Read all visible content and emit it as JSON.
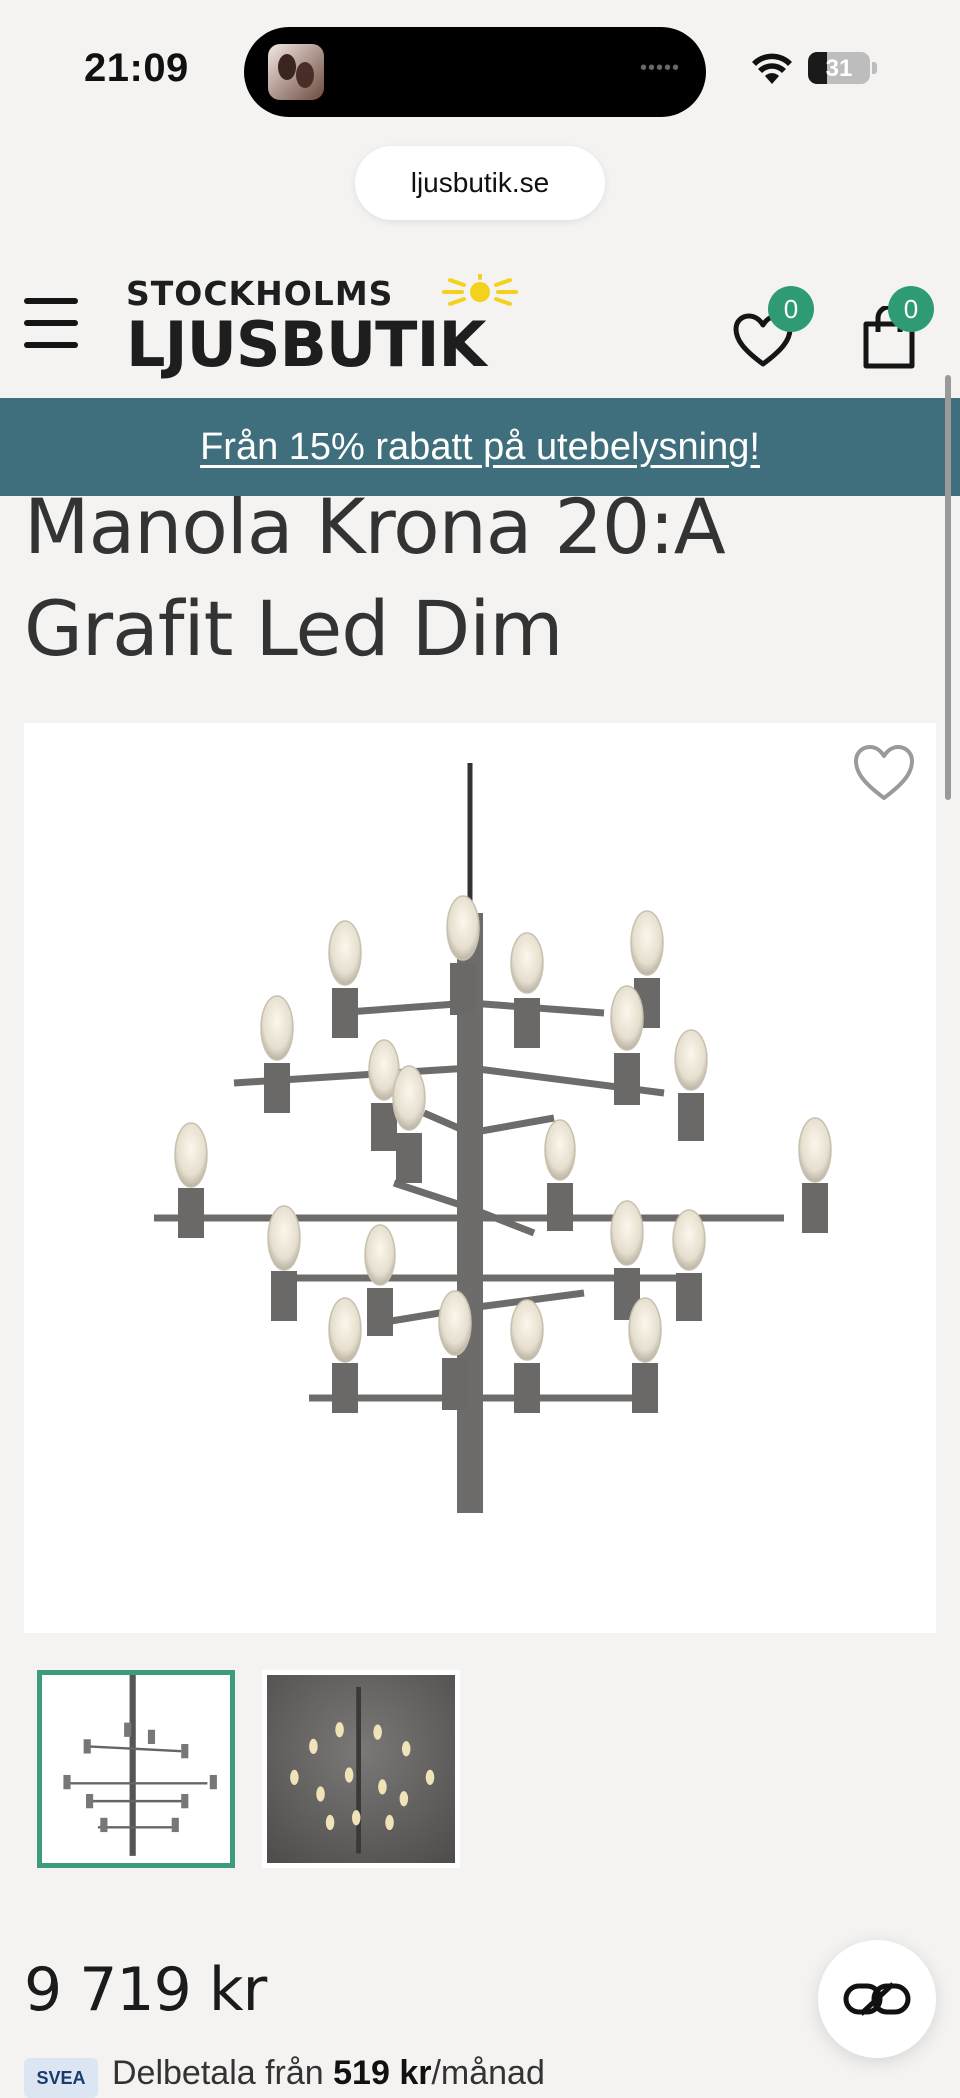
{
  "status_bar": {
    "time": "21:09",
    "battery": "31"
  },
  "browser": {
    "url": "ljusbutik.se"
  },
  "header": {
    "logo_line1": "STOCKHOLMS",
    "logo_line2": "LJUSBUTIK",
    "wishlist_count": "0",
    "cart_count": "0"
  },
  "promo": {
    "text": "Från 15% rabatt på utebelysning!"
  },
  "product": {
    "title": "Manola Krona 20:A Grafit Led Dim",
    "price": "9 719 kr"
  },
  "payment": {
    "provider_logo": "SVEA",
    "prefix": "Delbetala från ",
    "amount": "519 kr",
    "suffix": "/månad"
  },
  "icons": {
    "menu": "hamburger-icon",
    "wishlist": "heart-icon",
    "cart": "shopping-bag-icon",
    "favorite": "heart-outline-icon",
    "chat": "chat-link-icon"
  },
  "colors": {
    "promo_bg": "#3f6f7c",
    "badge": "#2f9b73",
    "thumb_selected": "#3d9a7b"
  }
}
